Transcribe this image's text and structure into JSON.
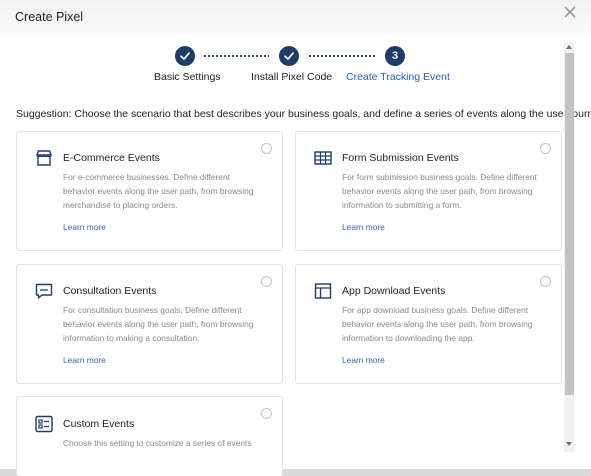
{
  "dialog": {
    "title": "Create Pixel"
  },
  "stepper": {
    "steps": [
      {
        "label": "Basic Settings",
        "number": "1",
        "state": "completed"
      },
      {
        "label": "Install Pixel Code",
        "number": "2",
        "state": "completed"
      },
      {
        "label": "Create Tracking Event",
        "number": "3",
        "state": "active"
      }
    ]
  },
  "suggestion": "Suggestion: Choose the scenario that best describes your business goals, and define a series of events along the user journey.",
  "cards": [
    {
      "icon": "storefront-icon",
      "title": "E-Commerce Events",
      "description": "For e-commerce businesses. Define different behavior events along the user path, from browsing merchandise to placing orders.",
      "link": "Learn more"
    },
    {
      "icon": "table-form-icon",
      "title": "Form Submission Events",
      "description": "For form submission business goals. Define different behavior events along the user path, from browsing information to submitting a form.",
      "link": "Learn more"
    },
    {
      "icon": "chat-bubble-icon",
      "title": "Consultation Events",
      "description": "For consultation business goals. Define different behavior events along the user path, from browsing information to making a consultation.",
      "link": "Learn more"
    },
    {
      "icon": "app-window-icon",
      "title": "App Download Events",
      "description": "For app download business goals. Define different behavior events along the user path, from browsing information to downloading the app.",
      "link": "Learn more"
    },
    {
      "icon": "custom-list-icon",
      "title": "Custom Events",
      "description": "Choose this setting to customize a series of events",
      "link": ""
    }
  ],
  "colors": {
    "primary_dark": "#1f3b66",
    "active_step": "#2b5cb8",
    "link": "#3b64b5"
  }
}
